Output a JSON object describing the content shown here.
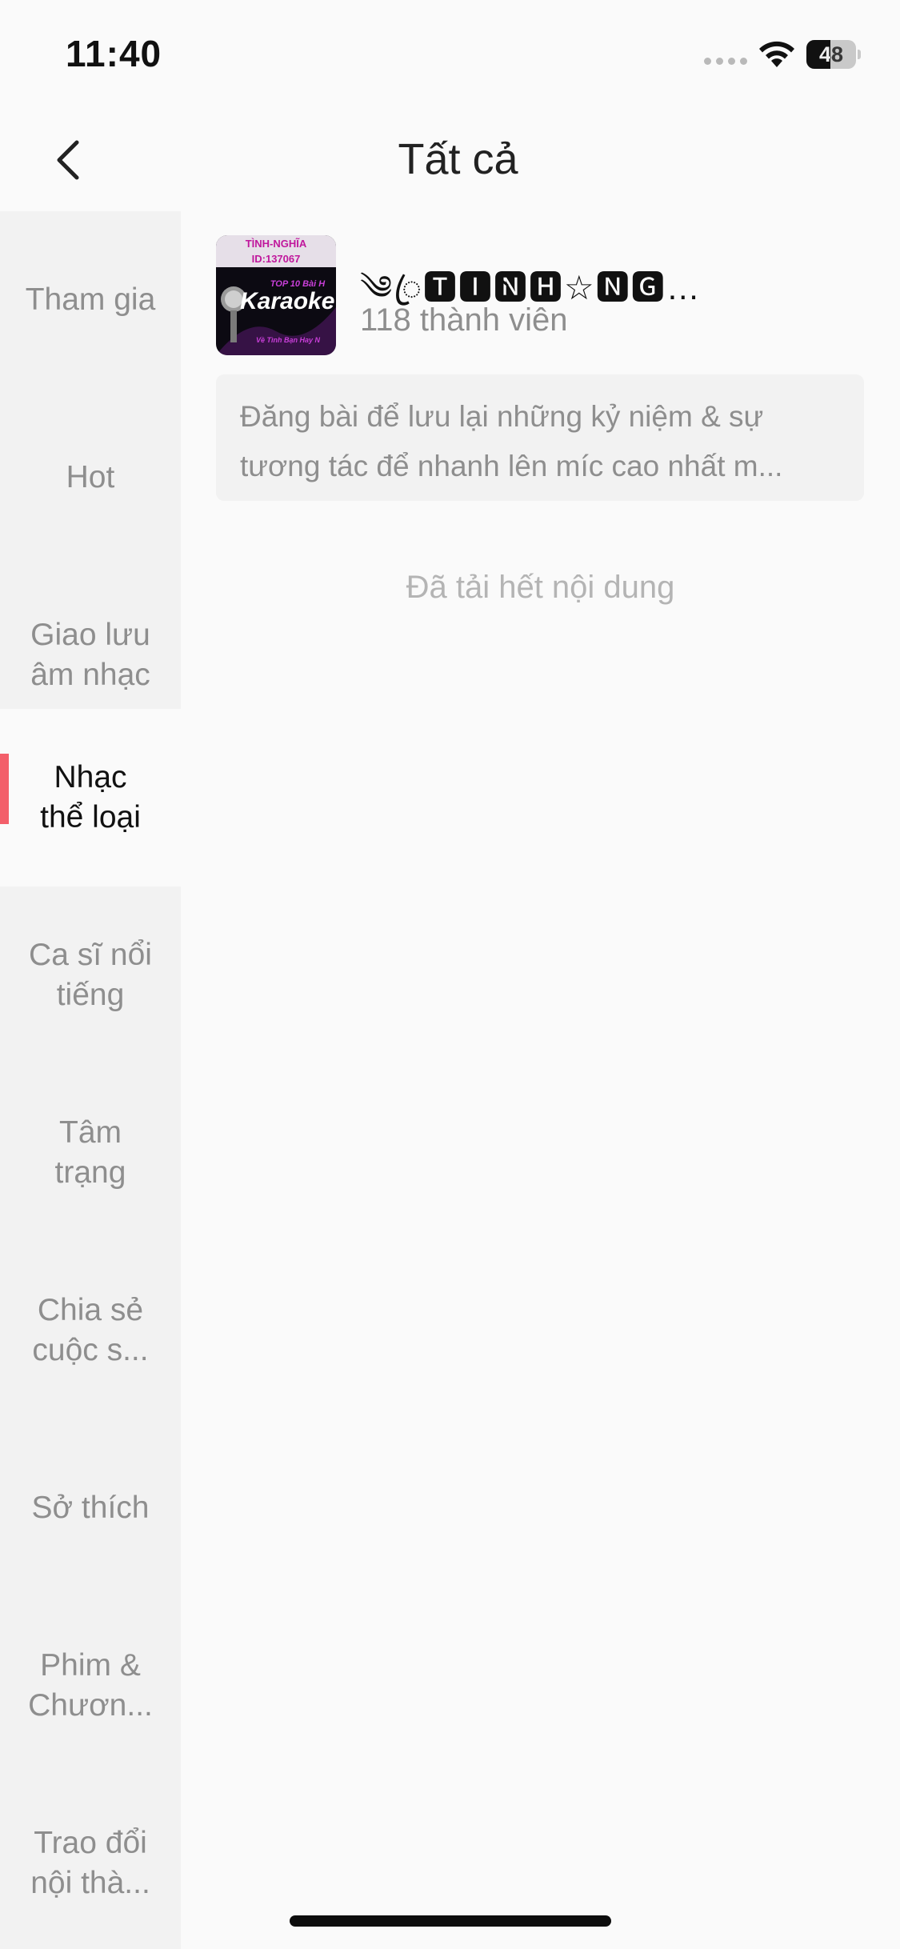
{
  "status_bar": {
    "time": "11:40",
    "battery_level": "48",
    "battery_fraction": 0.48,
    "icons": [
      "signal-dots-icon",
      "wifi-icon",
      "battery-icon"
    ]
  },
  "nav": {
    "title": "Tất cả",
    "back_icon": "chevron-left-icon"
  },
  "sidebar": {
    "items": [
      {
        "label": "Tham gia"
      },
      {
        "label": "Hot"
      },
      {
        "label": "Giao lưu âm nhạc"
      },
      {
        "label": "Nhạc thể loại"
      },
      {
        "label": "Ca sĩ nổi tiếng"
      },
      {
        "label": "Tâm trạng"
      },
      {
        "label": "Chia sẻ cuộc s..."
      },
      {
        "label": "Sở thích"
      },
      {
        "label": "Phim & Chươn..."
      },
      {
        "label": "Trao đổi nội thà..."
      }
    ],
    "active_index": 3,
    "active_color": "#f35f6a"
  },
  "group": {
    "name": "༄ꦿ🆃🅸̀🅽🅷☆🅽🅶🅷🅸̃...",
    "members": "118 thành viên",
    "description": "Đăng bài để lưu lại những kỷ niệm & sự tương tác để nhanh lên míc cao nhất m...",
    "avatar": {
      "top_text": "TÌNH-NGHĨA",
      "id_text": "ID:137067",
      "subtitle": "TOP 10 Bài H",
      "main_text": "Karaoke",
      "bottom_text": "Về Tình Bạn Hay N"
    }
  },
  "list_end_text": "Đã tải hết nội dung",
  "colors": {
    "accent": "#f35f6a",
    "background": "#fafafa",
    "sidebar_bg": "#f2f2f2",
    "muted_text": "#8e8e8e"
  }
}
